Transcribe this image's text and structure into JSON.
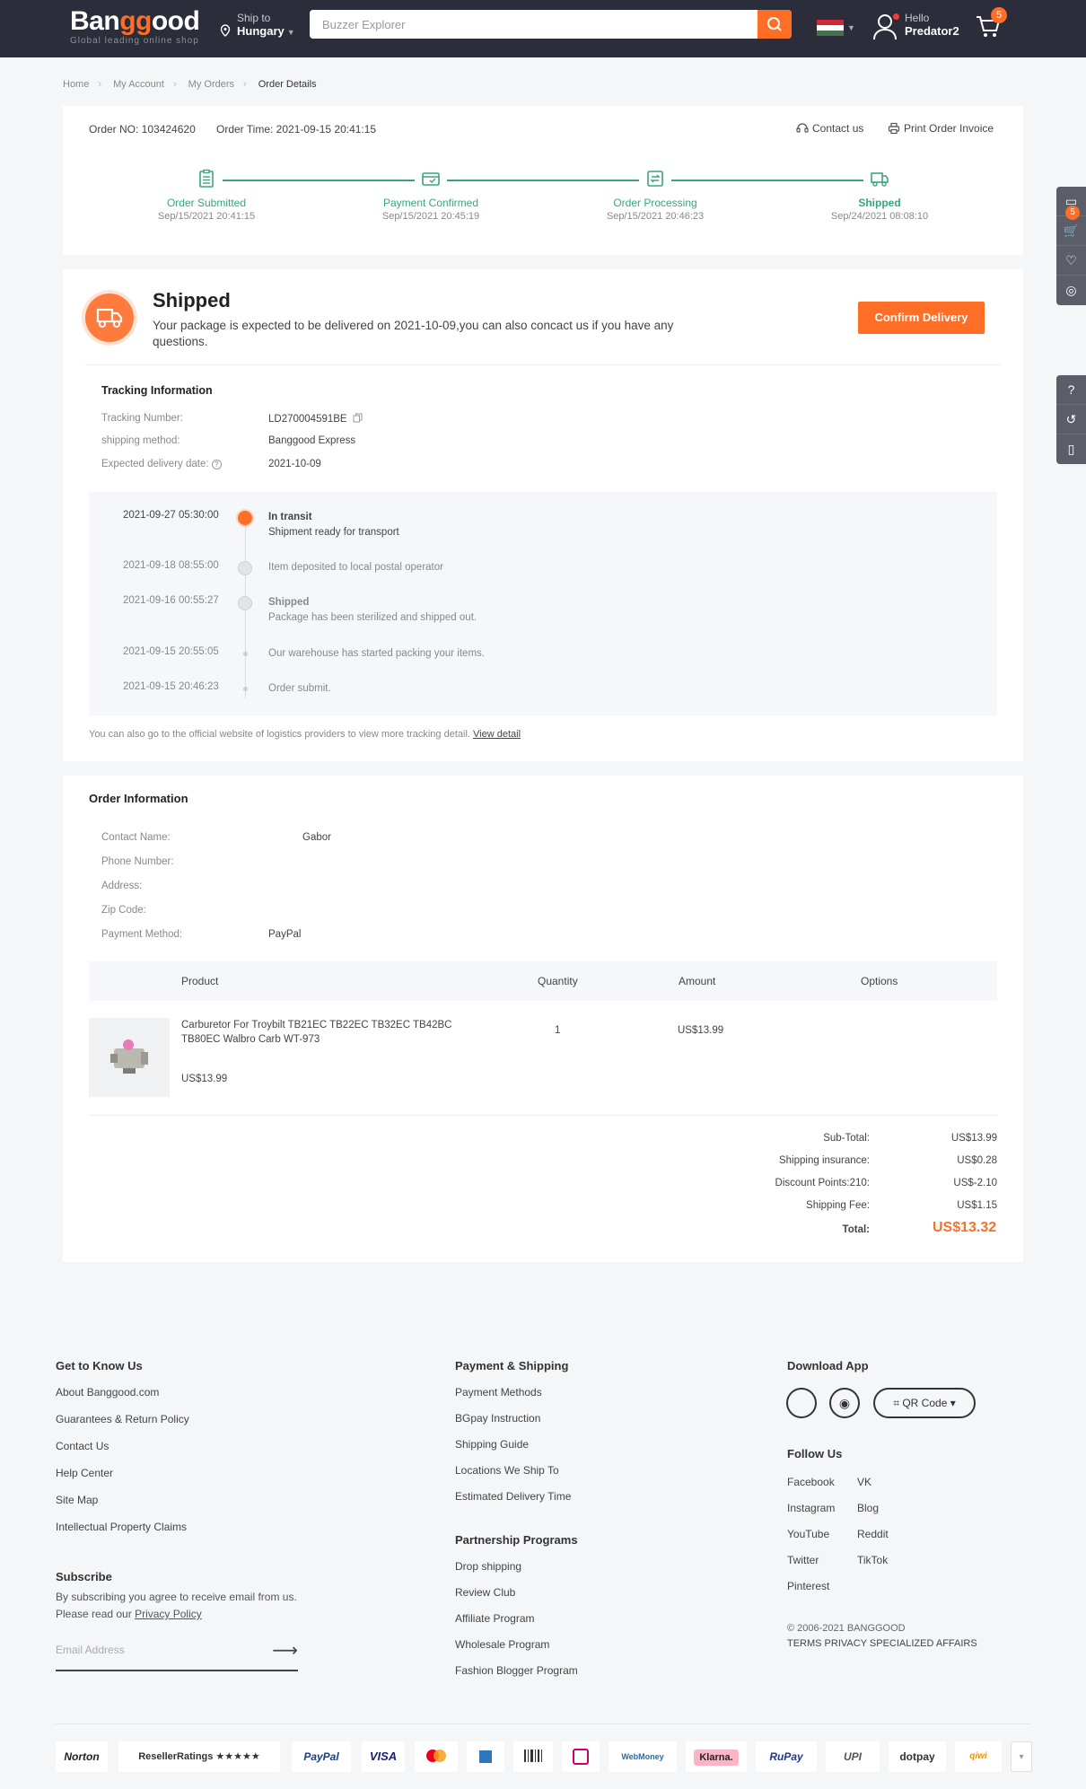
{
  "header": {
    "logo": "Banggood",
    "tagline": "Global leading online shop",
    "ship_to_label": "Ship to",
    "ship_to_country": "Hungary",
    "search_placeholder": "Buzzer Explorer",
    "user_greeting": "Hello",
    "user_name": "Predator2",
    "cart_count": "5"
  },
  "breadcrumb": [
    "Home",
    "My Account",
    "My Orders",
    "Order Details"
  ],
  "order": {
    "number": "Order NO: 103424620",
    "time": "Order Time: 2021-09-15 20:41:15",
    "contact": "Contact us",
    "print": "Print Order Invoice"
  },
  "steps": [
    {
      "title": "Order Submitted",
      "date": "Sep/15/2021 20:41:15",
      "icon": "clipboard-icon"
    },
    {
      "title": "Payment Confirmed",
      "date": "Sep/15/2021 20:45:19",
      "icon": "card-icon"
    },
    {
      "title": "Order Processing",
      "date": "Sep/15/2021 20:46:23",
      "icon": "box-icon"
    },
    {
      "title": "Shipped",
      "date": "Sep/24/2021 08:08:10",
      "icon": "truck-icon"
    }
  ],
  "status": {
    "title": "Shipped",
    "description": "Your package is expected to be delivered on 2021-10-09,you can also concact us if you have any questions.",
    "confirm": "Confirm Delivery"
  },
  "tracking": {
    "title": "Tracking Information",
    "number_label": "Tracking Number:",
    "number": "LD270004591BE",
    "method_label": "shipping method:",
    "method": "Banggood Express",
    "expected_label": "Expected delivery date:",
    "expected": "2021-10-09",
    "events": [
      {
        "time": "2021-09-27 05:30:00",
        "title": "In transit",
        "detail": "Shipment ready for transport"
      },
      {
        "time": "2021-09-18 08:55:00",
        "title": "",
        "detail": "Item deposited to local postal operator"
      },
      {
        "time": "2021-09-16 00:55:27",
        "title": "Shipped",
        "detail": "Package has been sterilized and shipped out."
      },
      {
        "time": "2021-09-15 20:55:05",
        "title": "",
        "detail": "Our warehouse has started packing your items."
      },
      {
        "time": "2021-09-15 20:46:23",
        "title": "",
        "detail": "Order submit."
      }
    ],
    "note": "You can also go to the official website of logistics providers to view more tracking detail.",
    "note_link": "View detail"
  },
  "order_info": {
    "title": "Order Information",
    "contact_label": "Contact Name:",
    "contact": "Gabor",
    "phone_label": "Phone Number:",
    "address_label": "Address:",
    "zip_label": "Zip Code:",
    "payment_label": "Payment Method:",
    "payment": "PayPal",
    "columns": [
      "Product",
      "Quantity",
      "Amount",
      "Options"
    ],
    "product": {
      "name": "Carburetor For Troybilt TB21EC TB22EC TB32EC TB42BC TB80EC Walbro Carb WT-973",
      "price": "US$13.99",
      "qty": "1",
      "amount": "US$13.99"
    },
    "summary": [
      {
        "label": "Sub-Total:",
        "value": "US$13.99"
      },
      {
        "label": "Shipping insurance:",
        "value": "US$0.28"
      },
      {
        "label": "Discount Points:210:",
        "value": "US$-2.10"
      },
      {
        "label": "Shipping Fee:",
        "value": "US$1.15"
      }
    ],
    "total_label": "Total:",
    "total": "US$13.32"
  },
  "footer": {
    "col1_title": "Get to Know Us",
    "col1": [
      "About Banggood.com",
      "Guarantees & Return Policy",
      "Contact Us",
      "Help Center",
      "Site Map",
      "Intellectual Property Claims"
    ],
    "subscribe_title": "Subscribe",
    "subscribe_text": "By subscribing you agree to receive email from us.",
    "subscribe_text2": "Please read our",
    "privacy": "Privacy Policy",
    "email_placeholder": "Email Address",
    "col2_title": "Payment & Shipping",
    "col2": [
      "Payment Methods",
      "BGpay Instruction",
      "Shipping Guide",
      "Locations We Ship To",
      "Estimated Delivery Time"
    ],
    "col3_title": "Partnership Programs",
    "col3": [
      "Drop shipping",
      "Review Club",
      "Affiliate Program",
      "Wholesale Program",
      "Fashion Blogger Program"
    ],
    "app_title": "Download App",
    "qr": "QR Code",
    "follow_title": "Follow Us",
    "follow_left": [
      "Facebook",
      "Instagram",
      "YouTube",
      "Twitter",
      "Pinterest"
    ],
    "follow_right": [
      "VK",
      "Blog",
      "Reddit",
      "TikTok"
    ],
    "copyright": "© 2006-2021 BANGGOOD",
    "links": "TERMS  PRIVACY  SPECIALIZED AFFAIRS",
    "payments": [
      "Norton",
      "ResellerRatings ★★★★★",
      "PayPal",
      "VISA",
      "",
      "",
      "",
      "",
      "WebMoney",
      "Klarna.",
      "RuPay",
      "UPI",
      "dotpay",
      "qiwi"
    ]
  },
  "colors": {
    "accent": "#ff6e26",
    "green": "#3aa678",
    "header": "#2b2d3a"
  }
}
